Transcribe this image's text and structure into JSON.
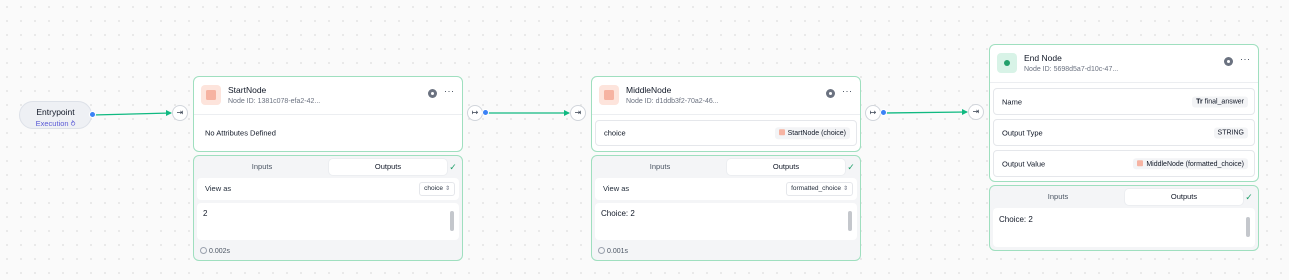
{
  "entrypoint": {
    "title": "Entrypoint",
    "subtitle": "Execution",
    "subtitle_icon": "branch-icon"
  },
  "nodes": [
    {
      "title": "StartNode",
      "node_id": "Node ID:  1381c078-efa2-42...",
      "empty_text": "No Attributes Defined",
      "panel": {
        "tabs": [
          "Inputs",
          "Outputs"
        ],
        "active_tab": "Outputs",
        "view_as_label": "View as",
        "view_as_value": "choice",
        "output_value": "2",
        "timing": "0.002s"
      }
    },
    {
      "title": "MiddleNode",
      "node_id": "Node ID:  d1ddb3f2-70a2-46...",
      "attribute": {
        "label": "choice",
        "value": "StartNode (choice)"
      },
      "panel": {
        "tabs": [
          "Inputs",
          "Outputs"
        ],
        "active_tab": "Outputs",
        "view_as_label": "View as",
        "view_as_value": "formatted_choice",
        "output_value": "Choice: 2",
        "timing": "0.001s"
      }
    },
    {
      "title": "End Node",
      "node_id": "Node ID:  5698d5a7-d10c-47...",
      "attributes": [
        {
          "label": "Name",
          "prefix": "Tr",
          "value": "final_answer"
        },
        {
          "label": "Output Type",
          "value": "STRING"
        },
        {
          "label": "Output Value",
          "value": "MiddleNode (formatted_choice)"
        }
      ],
      "panel": {
        "tabs": [
          "Inputs",
          "Outputs"
        ],
        "active_tab": "Outputs",
        "output_value": "Choice: 2"
      }
    }
  ],
  "colors": {
    "accent_green": "#22a06b",
    "edge": "#10b981",
    "handle": "#3b82f6",
    "border": "#9fdfbf",
    "subtitle": "#5b5bd6"
  }
}
